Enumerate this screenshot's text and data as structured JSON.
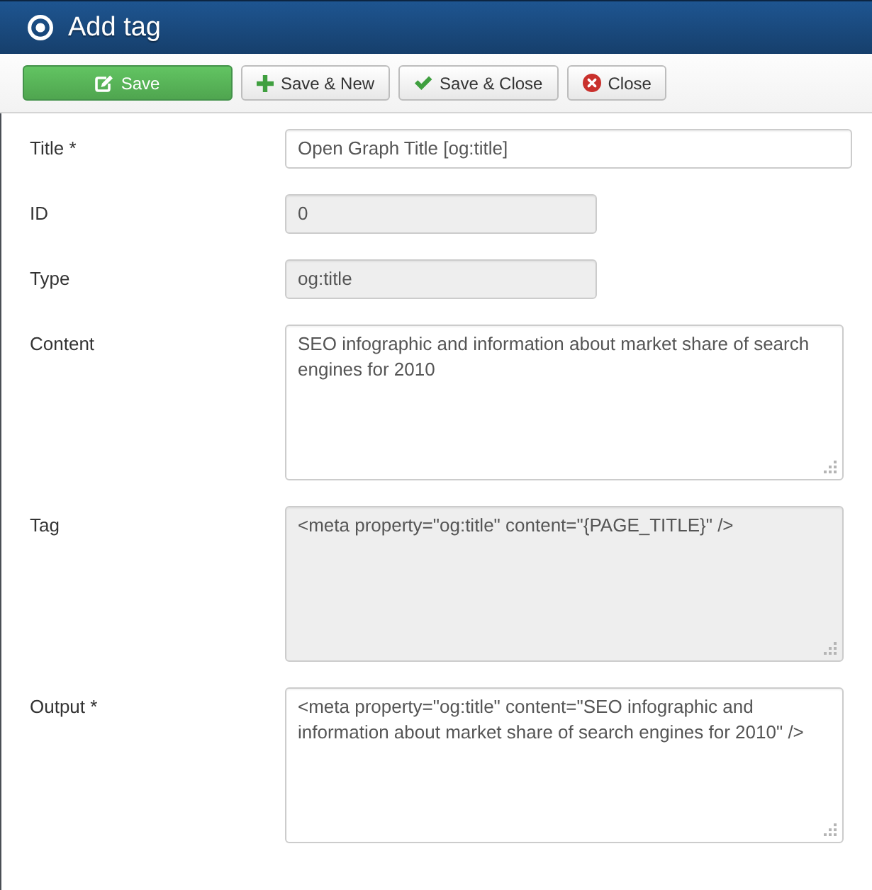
{
  "window": {
    "title": "Add tag"
  },
  "toolbar": {
    "buttons": [
      {
        "label": "Save",
        "kind": "primary"
      },
      {
        "label": "Save & New",
        "kind": "default"
      },
      {
        "label": "Save & Close",
        "kind": "default"
      },
      {
        "label": "Close",
        "kind": "default"
      }
    ]
  },
  "form": {
    "fields": [
      {
        "label": "Title *",
        "kind": "text",
        "value": "Open Graph Title [og:title]",
        "disabled": false
      },
      {
        "label": "ID",
        "kind": "short",
        "value": "0",
        "disabled": true
      },
      {
        "label": "Type",
        "kind": "short",
        "value": "og:title",
        "disabled": true
      },
      {
        "label": "Content",
        "kind": "textarea",
        "value": "SEO infographic and information about market share of search engines for 2010",
        "disabled": false
      },
      {
        "label": "Tag",
        "kind": "textarea",
        "value": "<meta property=\"og:title\" content=\"{PAGE_TITLE}\" />",
        "disabled": true
      },
      {
        "label": "Output *",
        "kind": "textarea",
        "value": "<meta property=\"og:title\" content=\"SEO infographic and information about market share of search engines for 2010\" />",
        "disabled": false
      }
    ]
  }
}
